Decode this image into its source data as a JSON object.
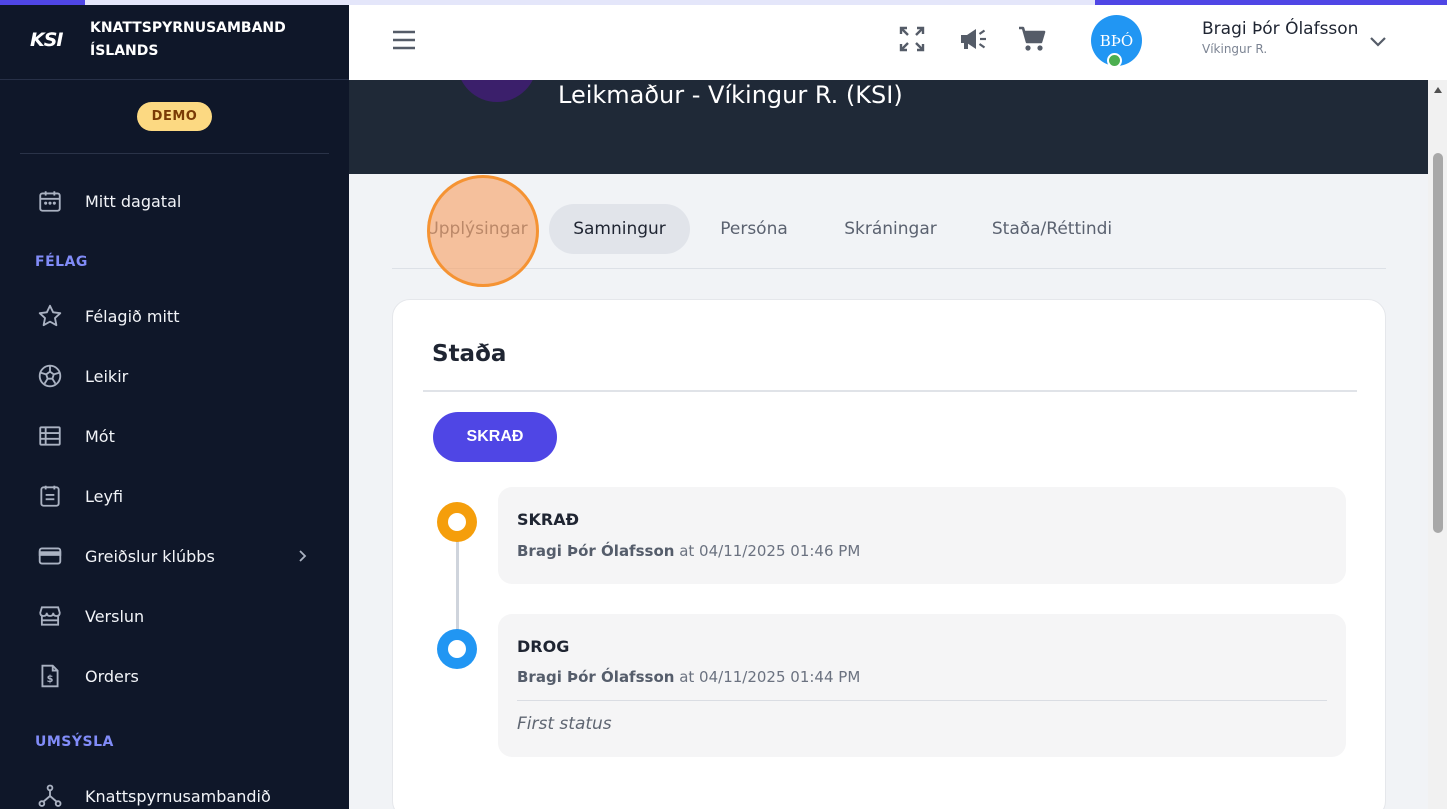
{
  "sidebar": {
    "logo_text": "KSI",
    "org_name": "KNATTSPYRNUSAMBAND ÍSLANDS",
    "demo_badge": "DEMO",
    "items": [
      {
        "label": "Mitt dagatal",
        "icon": "calendar-icon"
      },
      {
        "label": "Félagið mitt",
        "icon": "star-icon"
      },
      {
        "label": "Leikir",
        "icon": "soccer-ball-icon"
      },
      {
        "label": "Mót",
        "icon": "list-icon"
      },
      {
        "label": "Leyfi",
        "icon": "document-icon"
      },
      {
        "label": "Greiðslur klúbbs",
        "icon": "credit-card-icon"
      },
      {
        "label": "Verslun",
        "icon": "storefront-icon"
      },
      {
        "label": "Orders",
        "icon": "invoice-icon"
      },
      {
        "label": "Knattspyrnusambandið",
        "icon": "hierarchy-icon"
      }
    ],
    "sections": [
      "FÉLAG",
      "UMSÝSLA"
    ]
  },
  "header": {
    "avatar_initials": "BÞÓ",
    "user_name": "Bragi Þór Ólafsson",
    "user_club": "Víkingur R."
  },
  "hero": {
    "title": "Leikmaður - Víkingur R. (KSI)"
  },
  "tabs": [
    {
      "label": "Upplýsingar",
      "active": false
    },
    {
      "label": "Samningur",
      "active": true
    },
    {
      "label": "Persóna",
      "active": false
    },
    {
      "label": "Skráningar",
      "active": false
    },
    {
      "label": "Staða/Réttindi",
      "active": false
    }
  ],
  "status_card": {
    "title": "Staða",
    "button_label": "SKRAÐ",
    "timeline": [
      {
        "status": "SKRAÐ",
        "user": "Bragi Þór Ólafsson",
        "at_text": "at 04/11/2025 01:46 PM",
        "color": "#f59e0b",
        "note": ""
      },
      {
        "status": "DROG",
        "user": "Bragi Þór Ólafsson",
        "at_text": "at 04/11/2025 01:44 PM",
        "color": "#2196f3",
        "note": "First status"
      }
    ]
  },
  "colors": {
    "sidebar_bg": "#0f1729",
    "accent": "#4f46e5",
    "section_label": "#818cf8",
    "hero_bg": "#1f2937"
  }
}
